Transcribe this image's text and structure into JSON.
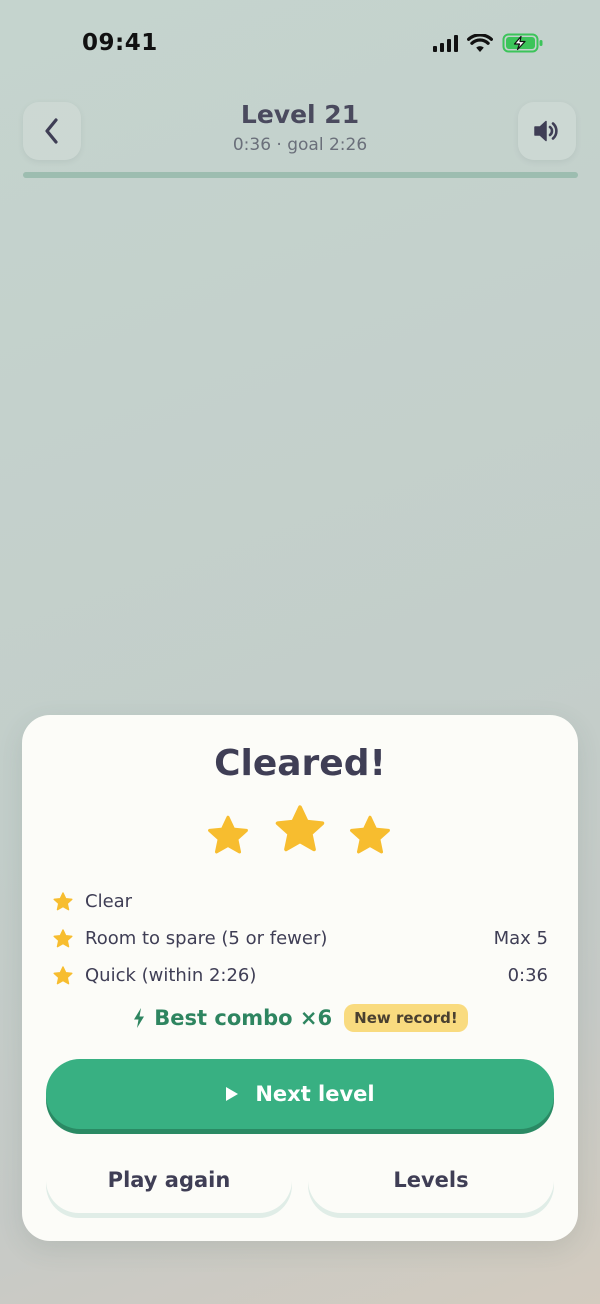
{
  "status_bar": {
    "time": "09:41",
    "icons": [
      "cellular-signal-icon",
      "wifi-icon",
      "battery-charging-icon"
    ]
  },
  "header": {
    "back_icon": "chevron-left-icon",
    "title": "Level 21",
    "subtitle": "0:36 · goal 2:26",
    "sound_icon": "speaker-icon"
  },
  "result": {
    "title": "Cleared!",
    "stars_earned": 3,
    "stars_total": 3,
    "criteria": [
      {
        "label": "Clear",
        "value": ""
      },
      {
        "label": "Room to spare (5 or fewer)",
        "value": "Max 5"
      },
      {
        "label": "Quick (within 2:26)",
        "value": "0:36"
      }
    ],
    "combo_text": "Best combo ×6",
    "combo_icon": "lightning-bolt-icon",
    "record_badge": "New record!",
    "next_button": "Next level",
    "play_again_button": "Play again",
    "levels_button": "Levels"
  },
  "colors": {
    "accent_green": "#38b082",
    "star_gold": "#f7bd2f",
    "badge_yellow": "#f9db7f",
    "card_bg": "#fcfcf8"
  }
}
